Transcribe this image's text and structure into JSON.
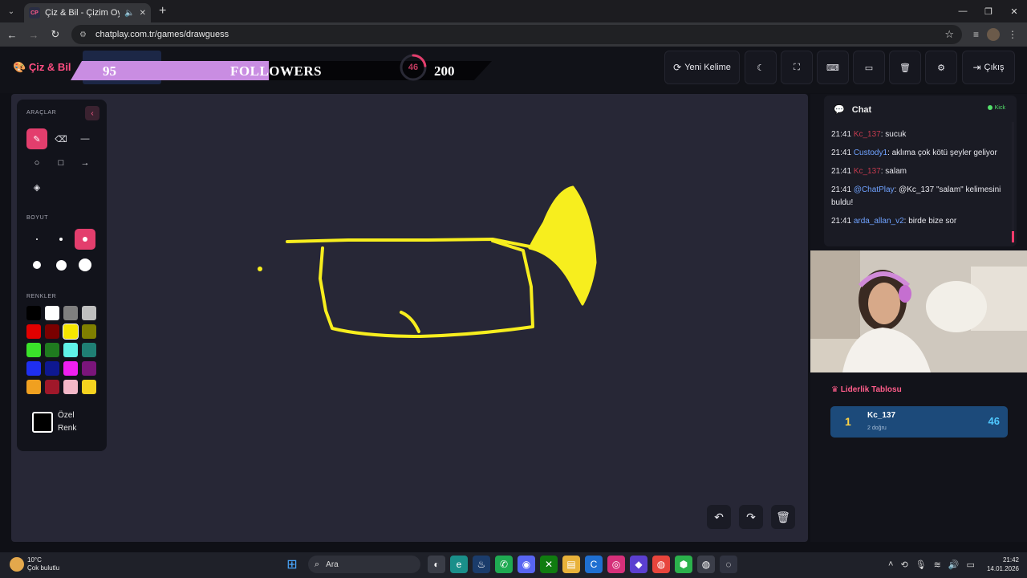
{
  "browser": {
    "tab_title": "Çiz & Bil - Çizim Oyunu",
    "tab_favicon_text": "CP",
    "url": "chatplay.com.tr/games/drawguess",
    "window_controls": [
      "—",
      "❐",
      "✕"
    ]
  },
  "header": {
    "logo": "Çiz & Bil",
    "followers_count": "95",
    "followers_label": "FOLLOWERS",
    "ring_value": "46",
    "ring_progress": 0.23,
    "goal_value": "200",
    "new_word_label": "Yeni Kelime",
    "exit_label": "Çıkış"
  },
  "tools": {
    "title": "ARAÇLAR",
    "size_title": "BOYUT",
    "colors_title": "RENKLER",
    "custom_color_line1": "Özel",
    "custom_color_line2": "Renk",
    "palette": [
      "#000000",
      "#ffffff",
      "#7f7f7f",
      "#bfbfbf",
      "#e10000",
      "#7a0000",
      "#f5e600",
      "#7f7f00",
      "#3ae22a",
      "#1f7a1f",
      "#5ff2e8",
      "#1f7f74",
      "#1f2ff0",
      "#0e1890",
      "#f01ff0",
      "#7a157a",
      "#f0a020",
      "#a0182a",
      "#f3b7c8",
      "#f5d21f"
    ],
    "selected_color": "#f5e600"
  },
  "chat": {
    "title": "Chat",
    "platform": "Kick",
    "messages": [
      {
        "time": "21:41",
        "user": "Kc_137",
        "text": ": sucuk"
      },
      {
        "time": "21:41",
        "user": "Custody1",
        "text": ": aklıma çok kötü şeyler geliyor"
      },
      {
        "time": "21:41",
        "user": "Kc_137",
        "text": ": salam"
      },
      {
        "time": "21:41",
        "user": "@ChatPlay",
        "text": ": @Kc_137 \"salam\" kelimesini buldu!"
      },
      {
        "time": "21:41",
        "user": "arda_allan_v2",
        "text": ": birde bize sor"
      }
    ]
  },
  "leaderboard": {
    "title": "Liderlik Tablosu",
    "rows": [
      {
        "rank": "1",
        "name": "Kc_137",
        "sub": "2 doğru",
        "score": "46"
      }
    ]
  },
  "taskbar": {
    "temp": "10°C",
    "weather": "Çok bulutlu",
    "search_label": "Ara",
    "time": "21:42",
    "date": "14.01.2026"
  },
  "colors": {
    "accent": "#e33e6d",
    "drawing_stroke": "#f7ee1e"
  }
}
